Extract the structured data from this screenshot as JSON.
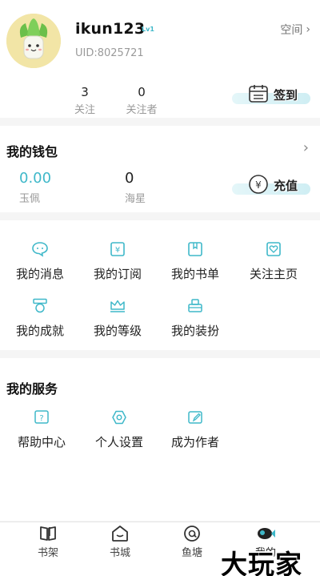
{
  "profile": {
    "username": "ikun123",
    "level_badge": "Lv1",
    "uid": "UID:8025721",
    "space_label": "空间",
    "following_count": "3",
    "following_label": "关注",
    "followers_count": "0",
    "followers_label": "关注者",
    "checkin_label": "签到"
  },
  "wallet": {
    "title": "我的钱包",
    "jade_value": "0.00",
    "jade_label": "玉佩",
    "star_value": "0",
    "star_label": "海星",
    "recharge_label": "充值"
  },
  "menu": {
    "items": [
      {
        "label": "我的消息",
        "icon": "message-icon"
      },
      {
        "label": "我的订阅",
        "icon": "subscription-icon"
      },
      {
        "label": "我的书单",
        "icon": "booklist-icon"
      },
      {
        "label": "关注主页",
        "icon": "heart-icon"
      },
      {
        "label": "我的成就",
        "icon": "medal-icon"
      },
      {
        "label": "我的等级",
        "icon": "crown-icon"
      },
      {
        "label": "我的装扮",
        "icon": "outfit-icon"
      }
    ]
  },
  "services": {
    "title": "我的服务",
    "items": [
      {
        "label": "帮助中心",
        "icon": "help-icon"
      },
      {
        "label": "个人设置",
        "icon": "settings-icon"
      },
      {
        "label": "成为作者",
        "icon": "author-icon"
      }
    ]
  },
  "bottom_nav": {
    "items": [
      {
        "label": "书架"
      },
      {
        "label": "书城"
      },
      {
        "label": "鱼塘"
      },
      {
        "label": "我的"
      }
    ]
  },
  "watermark": "大玩家",
  "colors": {
    "accent": "#3fb8c9",
    "background": "#f5f5f5"
  }
}
